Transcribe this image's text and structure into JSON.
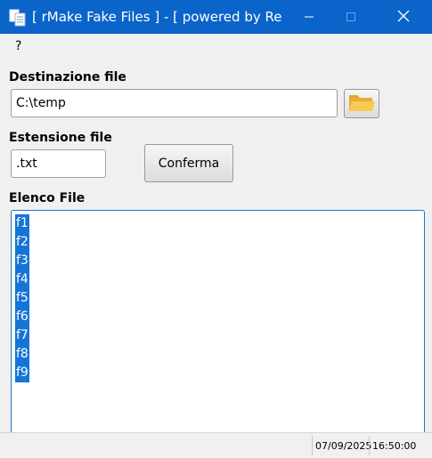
{
  "window": {
    "title": "[ rMake Fake Files ] - [ powered by Ren..."
  },
  "menu": {
    "items": [
      "?"
    ]
  },
  "destination": {
    "label": "Destinazione file",
    "value": "C:\\temp"
  },
  "extension": {
    "label": "Estensione file",
    "value": ".txt",
    "confirm_label": "Conferma"
  },
  "file_list": {
    "label": "Elenco File",
    "items": [
      "f1",
      "f2",
      "f3",
      "f4",
      "f5",
      "f6",
      "f7",
      "f8",
      "f9"
    ]
  },
  "status": {
    "date": "07/09/2025",
    "time": "16:50:00"
  },
  "colors": {
    "titlebar": "#0a64c9",
    "selection": "#1575d6",
    "folder": "#f3c04a"
  },
  "icons": {
    "app": "document-copy-icon",
    "folder": "folder-open-icon",
    "minimize": "minimize-icon",
    "maximize": "maximize-icon",
    "close": "close-icon"
  }
}
